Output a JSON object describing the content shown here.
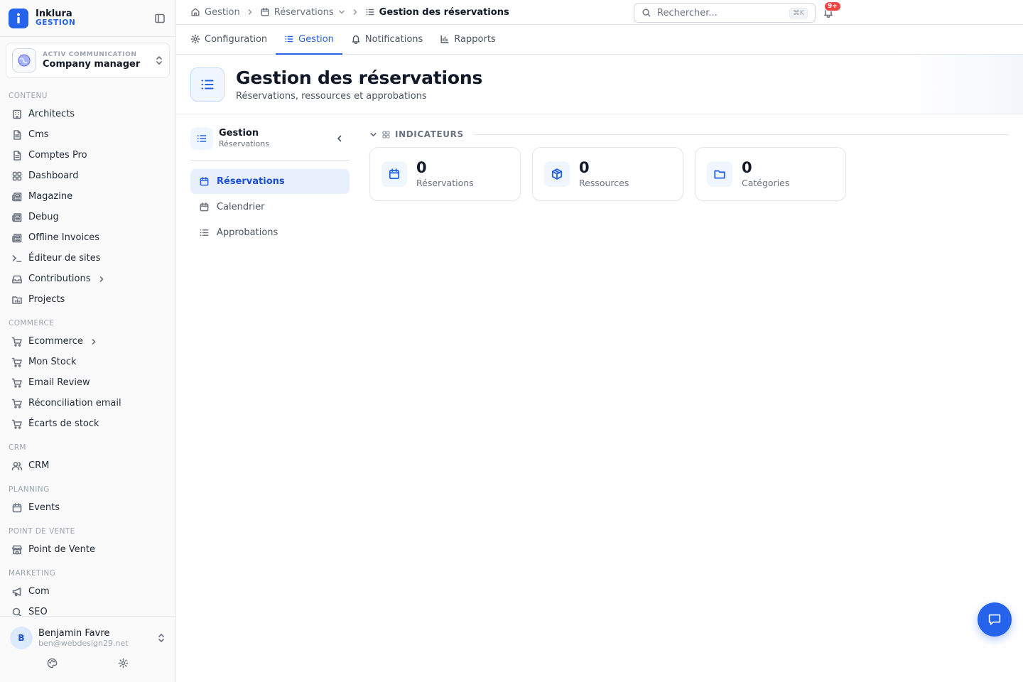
{
  "brand": {
    "name": "Inklura",
    "subtitle": "GESTION"
  },
  "org": {
    "label": "ACTIV COMMUNICATION",
    "name": "Company manager"
  },
  "sidebar": {
    "sections": [
      {
        "title": "CONTENU",
        "items": [
          {
            "label": "Architects",
            "icon": "building-icon"
          },
          {
            "label": "Cms",
            "icon": "file-icon"
          },
          {
            "label": "Comptes Pro",
            "icon": "file-icon"
          },
          {
            "label": "Dashboard",
            "icon": "grid-icon"
          },
          {
            "label": "Magazine",
            "icon": "newspaper-icon"
          },
          {
            "label": "Debug",
            "icon": "newspaper-icon"
          },
          {
            "label": "Offline Invoices",
            "icon": "newspaper-icon"
          },
          {
            "label": "Éditeur de sites",
            "icon": "terminal-icon"
          },
          {
            "label": "Contributions",
            "icon": "inbox-icon",
            "has_children": true
          },
          {
            "label": "Projects",
            "icon": "folder-chart-icon"
          }
        ]
      },
      {
        "title": "COMMERCE",
        "items": [
          {
            "label": "Ecommerce",
            "icon": "cart-icon",
            "has_children": true
          },
          {
            "label": "Mon Stock",
            "icon": "cart-icon"
          },
          {
            "label": "Email Review",
            "icon": "cart-icon"
          },
          {
            "label": "Réconciliation email",
            "icon": "cart-icon"
          },
          {
            "label": "Écarts de stock",
            "icon": "cart-icon"
          }
        ]
      },
      {
        "title": "CRM",
        "items": [
          {
            "label": "CRM",
            "icon": "users-icon"
          }
        ]
      },
      {
        "title": "PLANNING",
        "items": [
          {
            "label": "Events",
            "icon": "calendar-icon"
          }
        ]
      },
      {
        "title": "POINT DE VENTE",
        "items": [
          {
            "label": "Point de Vente",
            "icon": "store-icon"
          }
        ]
      },
      {
        "title": "MARKETING",
        "items": [
          {
            "label": "Com",
            "icon": "megaphone-icon"
          },
          {
            "label": "SEO",
            "icon": "search-icon"
          }
        ]
      }
    ]
  },
  "user": {
    "initial": "B",
    "name": "Benjamin Favre",
    "email": "ben@webdesign29.net"
  },
  "breadcrumb": {
    "items": [
      "Gestion",
      "Réservations"
    ],
    "current": "Gestion des réservations"
  },
  "search": {
    "placeholder": "Rechercher...",
    "shortcut": "⌘K"
  },
  "notifications": {
    "badge": "9+"
  },
  "tabs": [
    {
      "label": "Configuration",
      "icon": "gear-icon",
      "active": false
    },
    {
      "label": "Gestion",
      "icon": "list-icon",
      "active": true
    },
    {
      "label": "Notifications",
      "icon": "bell-icon",
      "active": false
    },
    {
      "label": "Rapports",
      "icon": "bar-chart-icon",
      "active": false
    }
  ],
  "page": {
    "title": "Gestion des réservations",
    "subtitle": "Réservations, ressources et approbations"
  },
  "subnav": {
    "title": "Gestion",
    "subtitle": "Réservations",
    "items": [
      {
        "label": "Réservations",
        "icon": "calendar-icon",
        "active": true
      },
      {
        "label": "Calendrier",
        "icon": "calendar-icon",
        "active": false
      },
      {
        "label": "Approbations",
        "icon": "list-icon",
        "active": false
      }
    ]
  },
  "indicators": {
    "title": "INDICATEURS",
    "cards": [
      {
        "value": "0",
        "label": "Réservations",
        "icon": "calendar-icon"
      },
      {
        "value": "0",
        "label": "Ressources",
        "icon": "box-icon"
      },
      {
        "value": "0",
        "label": "Catégories",
        "icon": "folder-icon"
      }
    ]
  },
  "colors": {
    "accent": "#2563eb",
    "badge": "#ef4444",
    "active_bg": "#e8f0fe"
  }
}
